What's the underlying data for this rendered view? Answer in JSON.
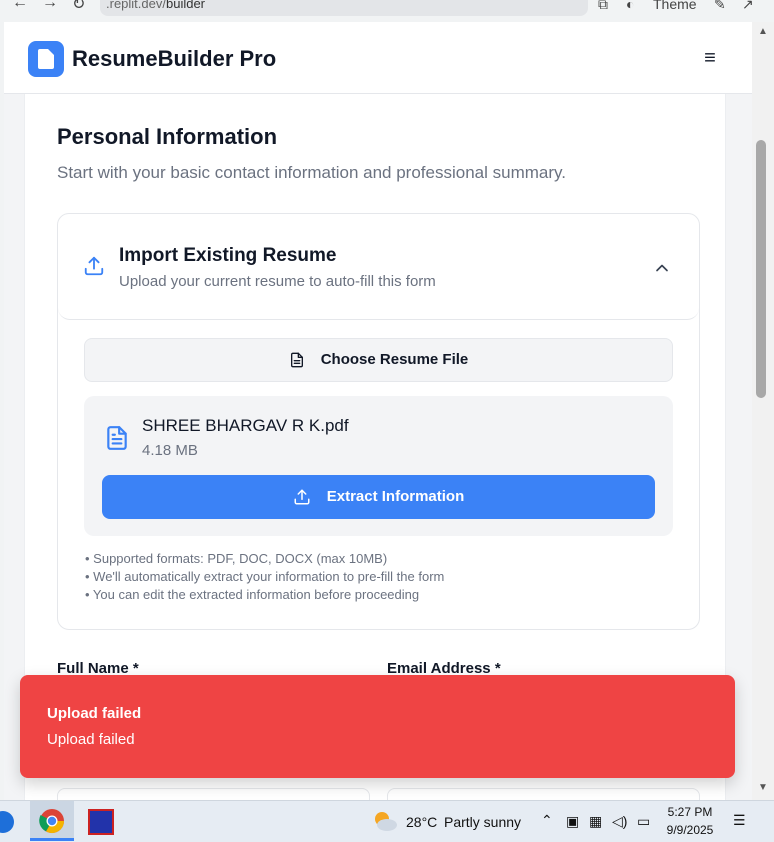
{
  "browser": {
    "url_host": ".replit.dev/",
    "url_path": "builder",
    "theme_label": "Theme"
  },
  "app": {
    "title": "ResumeBuilder Pro",
    "menu_icon": "≡"
  },
  "section": {
    "title": "Personal Information",
    "subtitle": "Start with your basic contact information and professional summary."
  },
  "import": {
    "title": "Import Existing Resume",
    "subtitle": "Upload your current resume to auto-fill this form",
    "choose_label": "Choose Resume File",
    "file_name": "SHREE BHARGAV R K.pdf",
    "file_size": "4.18 MB",
    "extract_label": "Extract Information",
    "notes": [
      "• Supported formats: PDF, DOC, DOCX (max 10MB)",
      "• We'll automatically extract your information to pre-fill the form",
      "• You can edit the extracted information before proceeding"
    ]
  },
  "fields": {
    "full_name_label": "Full Name *",
    "email_label": "Email Address *"
  },
  "toast": {
    "title": "Upload failed",
    "description": "Upload failed"
  },
  "taskbar": {
    "temperature": "28°C",
    "weather": "Partly sunny",
    "time": "5:27 PM",
    "date": "9/9/2025"
  },
  "colors": {
    "primary": "#3b82f6",
    "toast": "#ef4444"
  }
}
